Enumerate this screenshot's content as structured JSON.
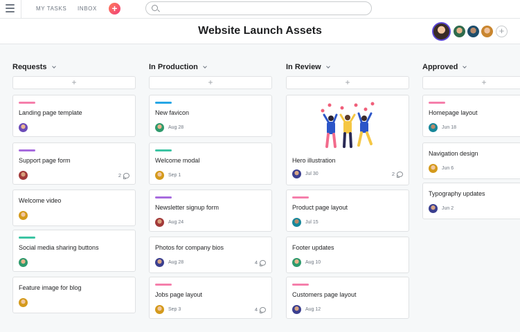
{
  "nav": {
    "my_tasks": "MY TASKS",
    "inbox": "INBOX",
    "add": "+"
  },
  "search": {
    "value": "",
    "placeholder": ""
  },
  "project": {
    "title": "Website Launch Assets",
    "add_member": "+"
  },
  "columns": [
    {
      "title": "Requests",
      "add": "+",
      "cards": [
        {
          "title": "Landing page template",
          "tag": "pink",
          "due": "",
          "comments": ""
        },
        {
          "title": "Support page form",
          "tag": "purple",
          "due": "",
          "comments": "2"
        },
        {
          "title": "Welcome video",
          "tag": "",
          "due": "",
          "comments": ""
        },
        {
          "title": "Social media sharing buttons",
          "tag": "teal",
          "due": "",
          "comments": ""
        },
        {
          "title": "Feature image for blog",
          "tag": "",
          "due": "",
          "comments": ""
        }
      ]
    },
    {
      "title": "In Production",
      "add": "+",
      "cards": [
        {
          "title": "New favicon",
          "tag": "blue",
          "due": "Aug 28",
          "comments": ""
        },
        {
          "title": "Welcome modal",
          "tag": "teal",
          "due": "Sep 1",
          "comments": ""
        },
        {
          "title": "Newsletter signup form",
          "tag": "purple",
          "due": "Aug 24",
          "comments": ""
        },
        {
          "title": "Photos for company bios",
          "tag": "",
          "due": "Aug 28",
          "comments": "4"
        },
        {
          "title": "Jobs page layout",
          "tag": "pink",
          "due": "Sep 3",
          "comments": "4"
        }
      ]
    },
    {
      "title": "In Review",
      "add": "+",
      "cards": [
        {
          "title": "Hero illustration",
          "tag": "",
          "due": "Jul 30",
          "comments": "2"
        },
        {
          "title": "Product page layout",
          "tag": "pink",
          "due": "Jul 15",
          "comments": ""
        },
        {
          "title": "Footer updates",
          "tag": "",
          "due": "Aug 10",
          "comments": ""
        },
        {
          "title": "Customers page layout",
          "tag": "pink",
          "due": "Aug 12",
          "comments": ""
        }
      ]
    },
    {
      "title": "Approved",
      "add": "+",
      "cards": [
        {
          "title": "Homepage layout",
          "tag": "pink",
          "due": "Jun 18",
          "comments": ""
        },
        {
          "title": "Navigation design",
          "tag": "",
          "due": "Jun 6",
          "comments": ""
        },
        {
          "title": "Typography updates",
          "tag": "",
          "due": "Jun 2",
          "comments": ""
        }
      ]
    }
  ],
  "colors": {
    "tag_pink": "#f57fab",
    "tag_purple": "#a76bde",
    "tag_teal": "#3cc4a3",
    "tag_blue": "#26a6e6",
    "add_button": "#f0407a"
  },
  "icons": {
    "menu": "hamburger-icon",
    "search": "search-icon",
    "comment": "comment-bubble-icon",
    "dropdown": "chevron-down-icon"
  }
}
